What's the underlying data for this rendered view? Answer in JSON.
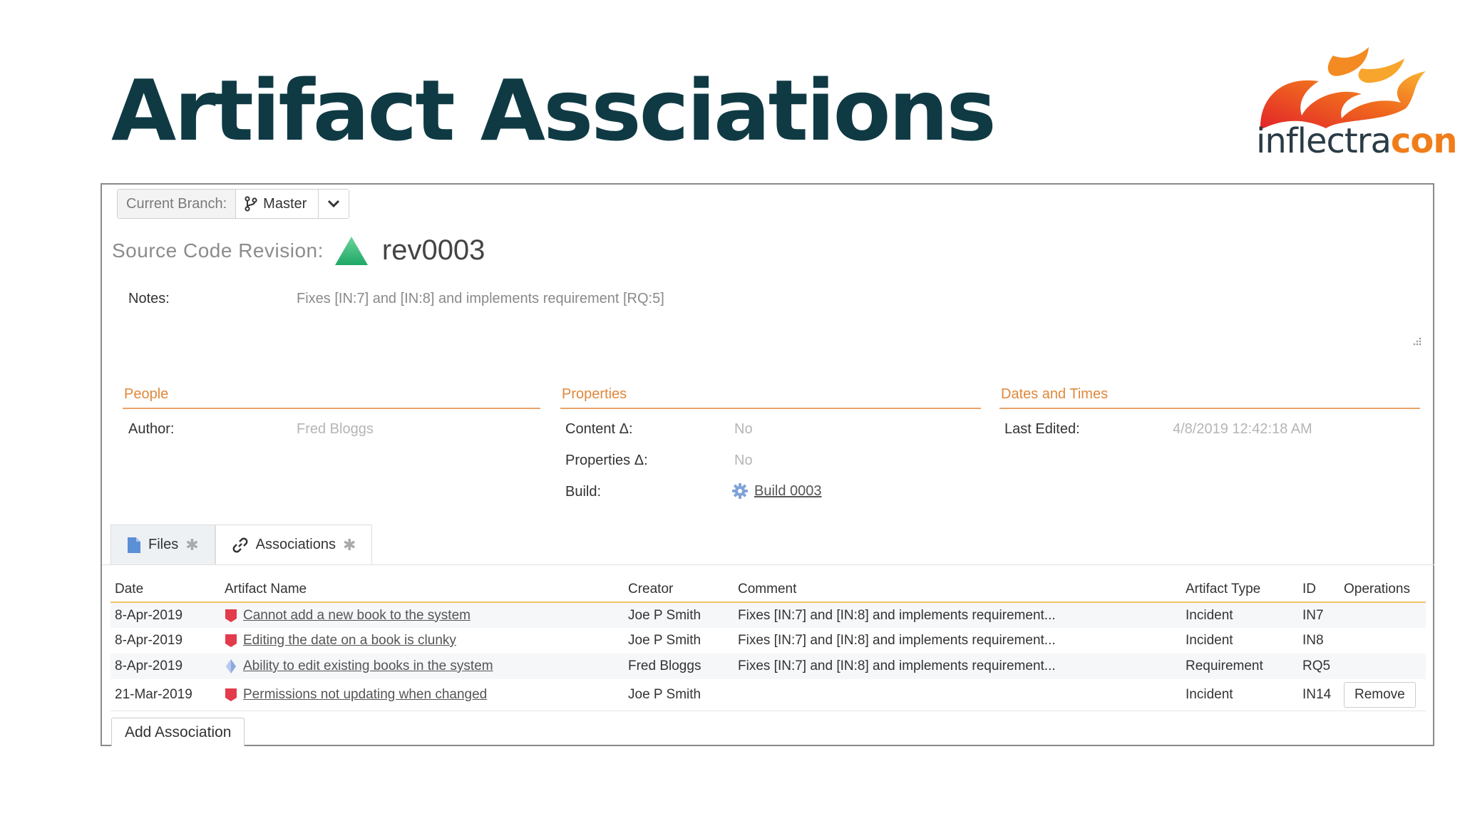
{
  "slide": {
    "title": "Artifact Assciations"
  },
  "logo": {
    "text_a": "inflectra",
    "text_b": "con"
  },
  "branch": {
    "label": "Current Branch:",
    "value": "Master"
  },
  "revision": {
    "label": "Source Code Revision:",
    "value": "rev0003"
  },
  "notes": {
    "label": "Notes:",
    "value": "Fixes [IN:7] and [IN:8] and implements requirement [RQ:5]"
  },
  "sections": {
    "people": "People",
    "properties": "Properties",
    "dates": "Dates and Times"
  },
  "fields": {
    "author_label": "Author:",
    "author_value": "Fred Bloggs",
    "content_label": "Content Δ:",
    "content_value": "No",
    "properties_label": "Properties Δ:",
    "properties_value": "No",
    "build_label": "Build:",
    "build_value": "Build 0003",
    "last_edited_label": "Last Edited:",
    "last_edited_value": "4/8/2019 12:42:18 AM"
  },
  "tabs": [
    {
      "label": "Files",
      "star": "✱"
    },
    {
      "label": "Associations",
      "star": "✱"
    }
  ],
  "table": {
    "headers": [
      "Date",
      "Artifact Name",
      "Creator",
      "Comment",
      "Artifact Type",
      "ID",
      "Operations"
    ],
    "rows": [
      {
        "date": "8-Apr-2019",
        "name": "Cannot add a new book to the system",
        "icon": "incident-icon",
        "creator": "Joe P Smith",
        "comment": "Fixes [IN:7] and [IN:8] and implements requirement...",
        "type": "Incident",
        "id": "IN7"
      },
      {
        "date": "8-Apr-2019",
        "name": "Editing the date on a book is clunky",
        "icon": "incident-icon",
        "creator": "Joe P Smith",
        "comment": "Fixes [IN:7] and [IN:8] and implements requirement...",
        "type": "Incident",
        "id": "IN8"
      },
      {
        "date": "8-Apr-2019",
        "name": "Ability to edit existing books in the system",
        "icon": "requirement-icon",
        "creator": "Fred Bloggs",
        "comment": "Fixes [IN:7] and [IN:8] and implements requirement...",
        "type": "Requirement",
        "id": "RQ5"
      },
      {
        "date": "21-Mar-2019",
        "name": "Permissions not updating when changed",
        "icon": "incident-icon",
        "creator": "Joe P Smith",
        "comment": "",
        "type": "Incident",
        "id": "IN14",
        "operation": "Remove"
      }
    ]
  },
  "actions": {
    "add_association": "Add Association"
  },
  "colors": {
    "title": "#0f3a44",
    "section_accent": "#e0883a",
    "incident": "#e23b4b",
    "requirement": "#8fa8e0",
    "revision": "#2fb873"
  }
}
